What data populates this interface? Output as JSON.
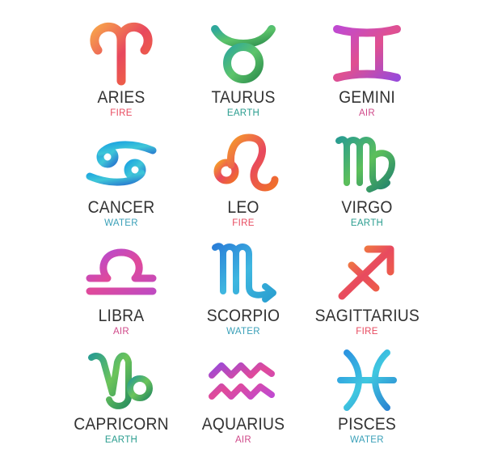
{
  "element_colors": {
    "fire": "#e84a5f",
    "earth": "#2a9d8f",
    "air": "#d04a8a",
    "water": "#3aa0b8"
  },
  "signs": [
    {
      "name": "ARIES",
      "element": "FIRE",
      "icon": "aries-icon",
      "color": "#e84a5f"
    },
    {
      "name": "TAURUS",
      "element": "EARTH",
      "icon": "taurus-icon",
      "color": "#2a9d8f"
    },
    {
      "name": "GEMINI",
      "element": "AIR",
      "icon": "gemini-icon",
      "color": "#d04a8a"
    },
    {
      "name": "CANCER",
      "element": "WATER",
      "icon": "cancer-icon",
      "color": "#3aa0b8"
    },
    {
      "name": "LEO",
      "element": "FIRE",
      "icon": "leo-icon",
      "color": "#e84a5f"
    },
    {
      "name": "VIRGO",
      "element": "EARTH",
      "icon": "virgo-icon",
      "color": "#2a9d8f"
    },
    {
      "name": "LIBRA",
      "element": "AIR",
      "icon": "libra-icon",
      "color": "#d04a8a"
    },
    {
      "name": "SCORPIO",
      "element": "WATER",
      "icon": "scorpio-icon",
      "color": "#3aa0b8"
    },
    {
      "name": "SAGITTARIUS",
      "element": "FIRE",
      "icon": "sagittarius-icon",
      "color": "#e84a5f"
    },
    {
      "name": "CAPRICORN",
      "element": "EARTH",
      "icon": "capricorn-icon",
      "color": "#2a9d8f"
    },
    {
      "name": "AQUARIUS",
      "element": "AIR",
      "icon": "aquarius-icon",
      "color": "#d04a8a"
    },
    {
      "name": "PISCES",
      "element": "WATER",
      "icon": "pisces-icon",
      "color": "#3aa0b8"
    }
  ]
}
